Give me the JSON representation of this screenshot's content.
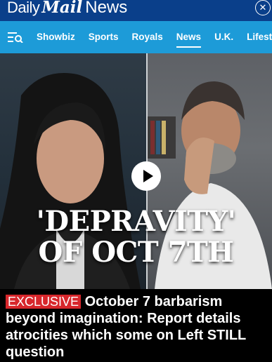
{
  "header": {
    "logo_daily": "Daily",
    "logo_mail": "Mail",
    "logo_news": "News",
    "close_icon": "close-icon"
  },
  "nav": {
    "menu_icon": "menu-search-icon",
    "items": [
      {
        "label": "Showbiz"
      },
      {
        "label": "Sports"
      },
      {
        "label": "Royals"
      },
      {
        "label": "News",
        "active": true
      },
      {
        "label": "U.K."
      },
      {
        "label": "Lifest"
      }
    ]
  },
  "hero": {
    "title_line1": "'DEPRAVITY'",
    "title_line2": "OF OCT 7TH",
    "play_icon": "play-icon"
  },
  "article": {
    "badge": "EXCLUSIVE",
    "headline": "October 7 barbarism beyond imagination: Report details atrocities which some on Left STILL question"
  },
  "colors": {
    "topbar": "#0a3f8a",
    "navbar": "#1d9bd8",
    "badge": "#d7262b",
    "background": "#000000"
  }
}
